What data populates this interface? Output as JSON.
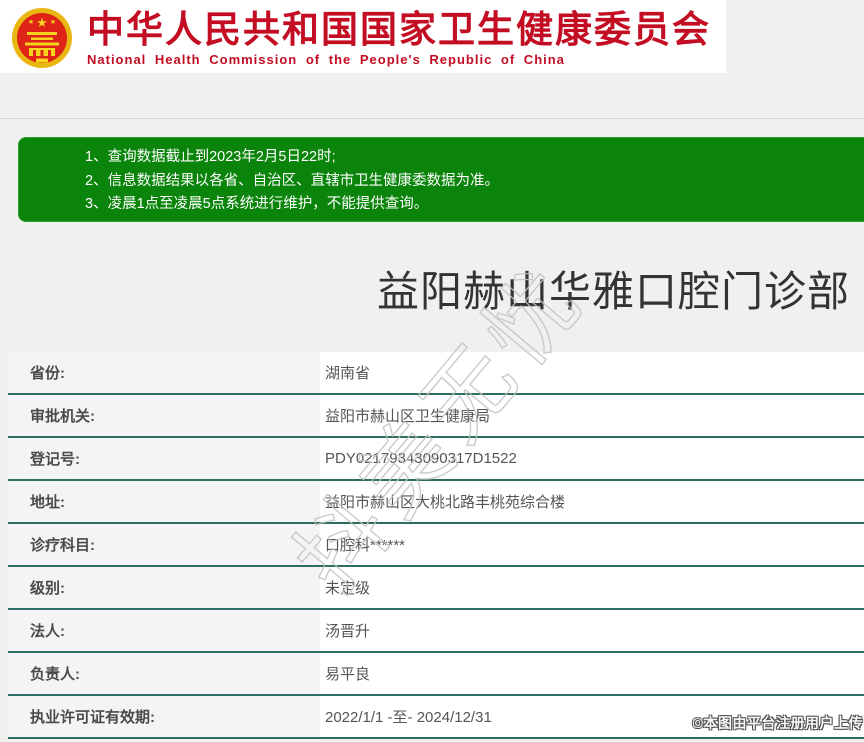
{
  "header": {
    "emblem_icon": "china-national-emblem-icon",
    "title_cn": "中华人民共和国国家卫生健康委员会",
    "title_en": "National Health Commission of the People's Republic of China"
  },
  "notice": {
    "lines": [
      "1、查询数据截止到2023年2月5日22时;",
      "2、信息数据结果以各省、自治区、直辖市卫生健康委数据为准。",
      "3、凌晨1点至凌晨5点系统进行维护，不能提供查询。"
    ]
  },
  "result": {
    "clinic_name": "益阳赫山华雅口腔门诊部",
    "fields": [
      {
        "label": "省份:",
        "value": "湖南省"
      },
      {
        "label": "审批机关:",
        "value": "益阳市赫山区卫生健康局"
      },
      {
        "label": "登记号:",
        "value": "PDY02179343090317D1522"
      },
      {
        "label": "地址:",
        "value": "益阳市赫山区大桃北路丰桃苑综合楼"
      },
      {
        "label": "诊疗科目:",
        "value": "口腔科******"
      },
      {
        "label": "级别:",
        "value": "未定级"
      },
      {
        "label": "法人:",
        "value": "汤晋升"
      },
      {
        "label": "负责人:",
        "value": "易平良"
      },
      {
        "label": "执业许可证有效期:",
        "value": "2022/1/1 -至- 2024/12/31"
      }
    ]
  },
  "watermark": {
    "diagonal_text": "抖美无忧",
    "corner_text": "©本图由平台注册用户上传"
  },
  "colors": {
    "brand_red": "#c30d23",
    "notice_green": "#0a840a",
    "table_border_teal": "#2e6d62",
    "label_bg": "#f4f4f4",
    "page_bg": "#f0f0ee"
  }
}
